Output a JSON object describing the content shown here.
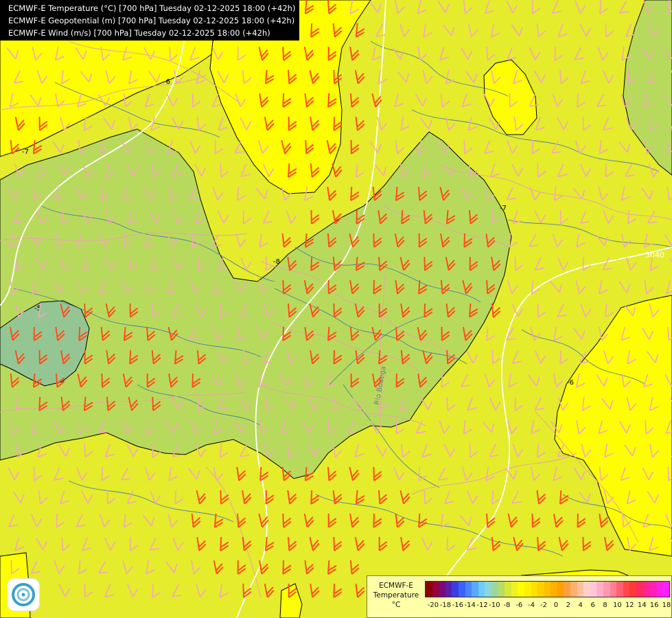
{
  "header": {
    "lines": [
      "ECMWF-E Temperature (°C) [700 hPa] Tuesday 02-12-2025 18:00 (+42h)",
      "ECMWF-E Geopotential (m) [700 hPa] Tuesday 02-12-2025 18:00 (+42h)",
      "ECMWF-E Wind (m/s) [700 hPa] Tuesday 02-12-2025 18:00 (+42h)"
    ]
  },
  "map": {
    "temperature_colors": {
      "warm_yellow": "#fefe00",
      "yellow_green": "#e4ec2c",
      "light_green": "#b8da5c",
      "teal_green": "#94c694"
    },
    "temperature_contour_labels": [
      "-6",
      "-7",
      "-7",
      "-8",
      "-6",
      "-5"
    ],
    "geopotential_contour_label": "3040",
    "river_label": "Rio Bodega",
    "contour_line_color": "#000000",
    "isohypse_color": "#ffffff",
    "wind_barb_colors": {
      "strong": "#ff4e1a",
      "weak": "#f5a6b8"
    },
    "border_color": "#e7a3a8",
    "river_color": "#3a6fb3"
  },
  "legend": {
    "title_line1": "ECMWF-E",
    "title_line2": "Temperature",
    "unit": "°C",
    "tick_labels": [
      "-20",
      "-18",
      "-16",
      "-14",
      "-12",
      "-10",
      "-8",
      "-6",
      "-4",
      "-2",
      "0",
      "2",
      "4",
      "6",
      "8",
      "10",
      "12",
      "14",
      "16",
      "18"
    ],
    "colors": [
      "#8b0000",
      "#9b0039",
      "#7a0a7a",
      "#5a20a8",
      "#3e3ee0",
      "#3a62ff",
      "#4a86ff",
      "#5aa8ff",
      "#6ecbff",
      "#8ad8d8",
      "#9ed6a0",
      "#b9dc60",
      "#d7e838",
      "#eef224",
      "#ffff00",
      "#fff000",
      "#ffe000",
      "#ffd000",
      "#ffc000",
      "#ffb000",
      "#ffa000",
      "#ffa040",
      "#ffb070",
      "#ffc0a0",
      "#ffd0c8",
      "#ffc8d8",
      "#ffb0c8",
      "#ff98b0",
      "#ff8090",
      "#ff6070",
      "#ff4848",
      "#ff3838",
      "#ff2a60",
      "#ff2490",
      "#ff20b8",
      "#ff20e0",
      "#ff20ff"
    ]
  }
}
